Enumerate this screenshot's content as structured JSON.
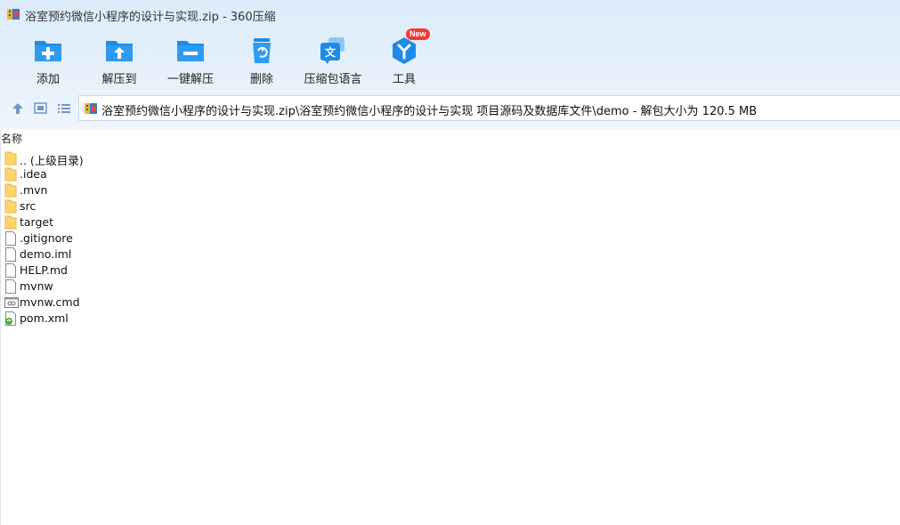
{
  "window": {
    "title": "浴室预约微信小程序的设计与实现.zip - 360压缩",
    "app_icon": "archive-icon"
  },
  "toolbar": {
    "items": [
      {
        "label": "添加",
        "icon": "add-folder-icon"
      },
      {
        "label": "解压到",
        "icon": "extract-to-icon"
      },
      {
        "label": "一键解压",
        "icon": "one-click-extract-icon"
      },
      {
        "label": "删除",
        "icon": "recycle-bin-icon"
      },
      {
        "label": "压缩包语言",
        "icon": "language-icon"
      },
      {
        "label": "工具",
        "icon": "tools-icon",
        "badge": "New"
      }
    ]
  },
  "navigation": {
    "path": "浴室预约微信小程序的设计与实现.zip\\浴室预约微信小程序的设计与实现 项目源码及数据库文件\\demo - 解包大小为 120.5 MB"
  },
  "file_list": {
    "column_name": "名称",
    "items": [
      {
        "name": ".. (上级目录)",
        "type": "folder"
      },
      {
        "name": ".idea",
        "type": "folder"
      },
      {
        "name": ".mvn",
        "type": "folder"
      },
      {
        "name": "src",
        "type": "folder"
      },
      {
        "name": "target",
        "type": "folder"
      },
      {
        "name": ".gitignore",
        "type": "file"
      },
      {
        "name": "demo.iml",
        "type": "file"
      },
      {
        "name": "HELP.md",
        "type": "file"
      },
      {
        "name": "mvnw",
        "type": "file"
      },
      {
        "name": "mvnw.cmd",
        "type": "cmd"
      },
      {
        "name": "pom.xml",
        "type": "xml"
      }
    ]
  },
  "colors": {
    "accent": "#1d8be8",
    "folder": "#ffd56b",
    "badge": "#f03a3a"
  }
}
